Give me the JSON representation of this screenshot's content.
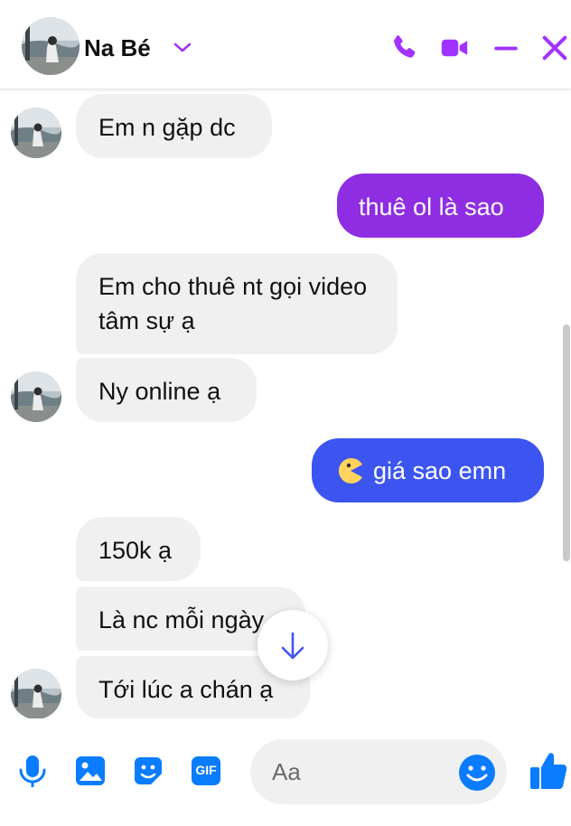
{
  "header": {
    "contact_name": "Na Bé"
  },
  "icons": {
    "chevron": "chevron-down-icon",
    "call": "phone-icon",
    "video": "video-call-icon",
    "minimize": "minimize-icon",
    "close": "close-icon",
    "mic": "microphone-icon",
    "image": "image-icon",
    "sticker": "sticker-icon",
    "gif": "gif-icon",
    "emoji": "emoji-icon",
    "like": "thumbs-up-icon",
    "scroll": "arrow-down-icon",
    "pacman": "pacman-emoji-icon"
  },
  "colors": {
    "accent": "#a033ff",
    "out_purple": "#8e2de2",
    "out_blue": "#3d55f0",
    "composer_icon": "#0a7cff"
  },
  "messages": [
    {
      "from": "them",
      "text": "Em n gặp dc"
    },
    {
      "from": "me",
      "text": "thuê ol là sao"
    },
    {
      "from": "them",
      "text": "Em cho thuê nt gọi video tâm sự ạ"
    },
    {
      "from": "them",
      "text": "Ny online ạ"
    },
    {
      "from": "me",
      "text": "giá sao emn"
    },
    {
      "from": "them",
      "text": "150k ạ"
    },
    {
      "from": "them",
      "text": "Là nc mỗi ngày"
    },
    {
      "from": "them",
      "text": "Tới lúc a chán ạ"
    }
  ],
  "composer": {
    "placeholder": "Aa",
    "gif_label": "GIF"
  }
}
